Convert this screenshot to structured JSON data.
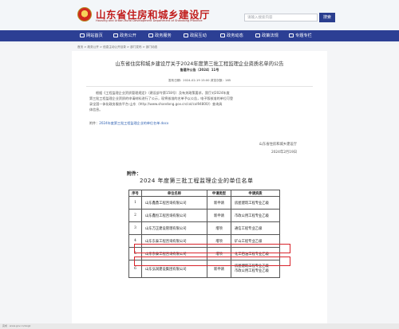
{
  "header": {
    "site_title": "山东省住房和城乡建设厅",
    "site_subtitle": "Housing and Urban-Rural Development Department of Shandong Province",
    "search_placeholder": "请输入搜索内容",
    "search_button": "搜索"
  },
  "nav": {
    "items": [
      {
        "label": "网站首页",
        "icon": "home-icon"
      },
      {
        "label": "政务公开",
        "icon": "document-icon"
      },
      {
        "label": "政务服务",
        "icon": "service-icon"
      },
      {
        "label": "政民互动",
        "icon": "chat-icon"
      },
      {
        "label": "政务动态",
        "icon": "news-icon"
      },
      {
        "label": "政策法规",
        "icon": "law-icon"
      },
      {
        "label": "专题专栏",
        "icon": "topic-icon"
      }
    ]
  },
  "breadcrumb": "首页 > 政务公开 > 信息主动公开目录 > 部门发布 > 部门动态",
  "article": {
    "title": "山东省住房和城乡建设厅关于2024年度第三批工程监理企业资质名单的公告",
    "doc_number": "鲁建许公告〔2024〕11号",
    "meta": "发布日期：2024-02-19 15:00    浏览次数：165",
    "paragraphs": [
      "根据《工程监理企业资质管理规定》（建设部令第158号）及有关政策要求，我厅对2024年度",
      "第三批工程监理企业资质的申请材料进行了公示，现将核准的名单予以公告，电子版核准的单位可登",
      "录全国一体化政务服务平台·山东（http://www.shandong.gov.cn/col/col94800/）查询具",
      "体信息。"
    ],
    "attachment_label": "附件：",
    "attachment_link": "2024年度第三批工程监理企业的单位名单.docx",
    "signature_org": "山东省住房和城乡建设厅",
    "signature_date": "2024年2月19日"
  },
  "document": {
    "attachment_heading": "附件：",
    "table_title": "2024 年度第三批工程监理企业的单位名单",
    "columns": [
      "序号",
      "单位名称",
      "申请类型",
      "申请资质"
    ],
    "rows": [
      {
        "no": "1",
        "name": "山东鑫鼎工程咨询有限公司",
        "type": "新申请",
        "qual": "房屋建筑工程专业乙级"
      },
      {
        "no": "2",
        "name": "山东鑫恒工程咨询有限公司",
        "type": "新申请",
        "qual": "市政公用工程专业乙级"
      },
      {
        "no": "3",
        "name": "山东万正建设管理有限公司",
        "type": "增项",
        "qual": "通信工程专业乙级"
      },
      {
        "no": "4",
        "name": "山东东泰工程咨询有限公司",
        "type": "增项",
        "qual": "矿山工程专业乙级"
      },
      {
        "no": "5",
        "name": "山东东泰工程咨询有限公司",
        "type": "增项",
        "qual": "化工石油工程专业乙级"
      },
      {
        "no": "6",
        "name": "山东弘润建设集团有限公司",
        "type": "新申请",
        "qual": "房屋建筑工程专业乙级\n市政公用工程专业乙级"
      }
    ]
  },
  "statusbar": "完成 · www.gov.cn/zwgk"
}
